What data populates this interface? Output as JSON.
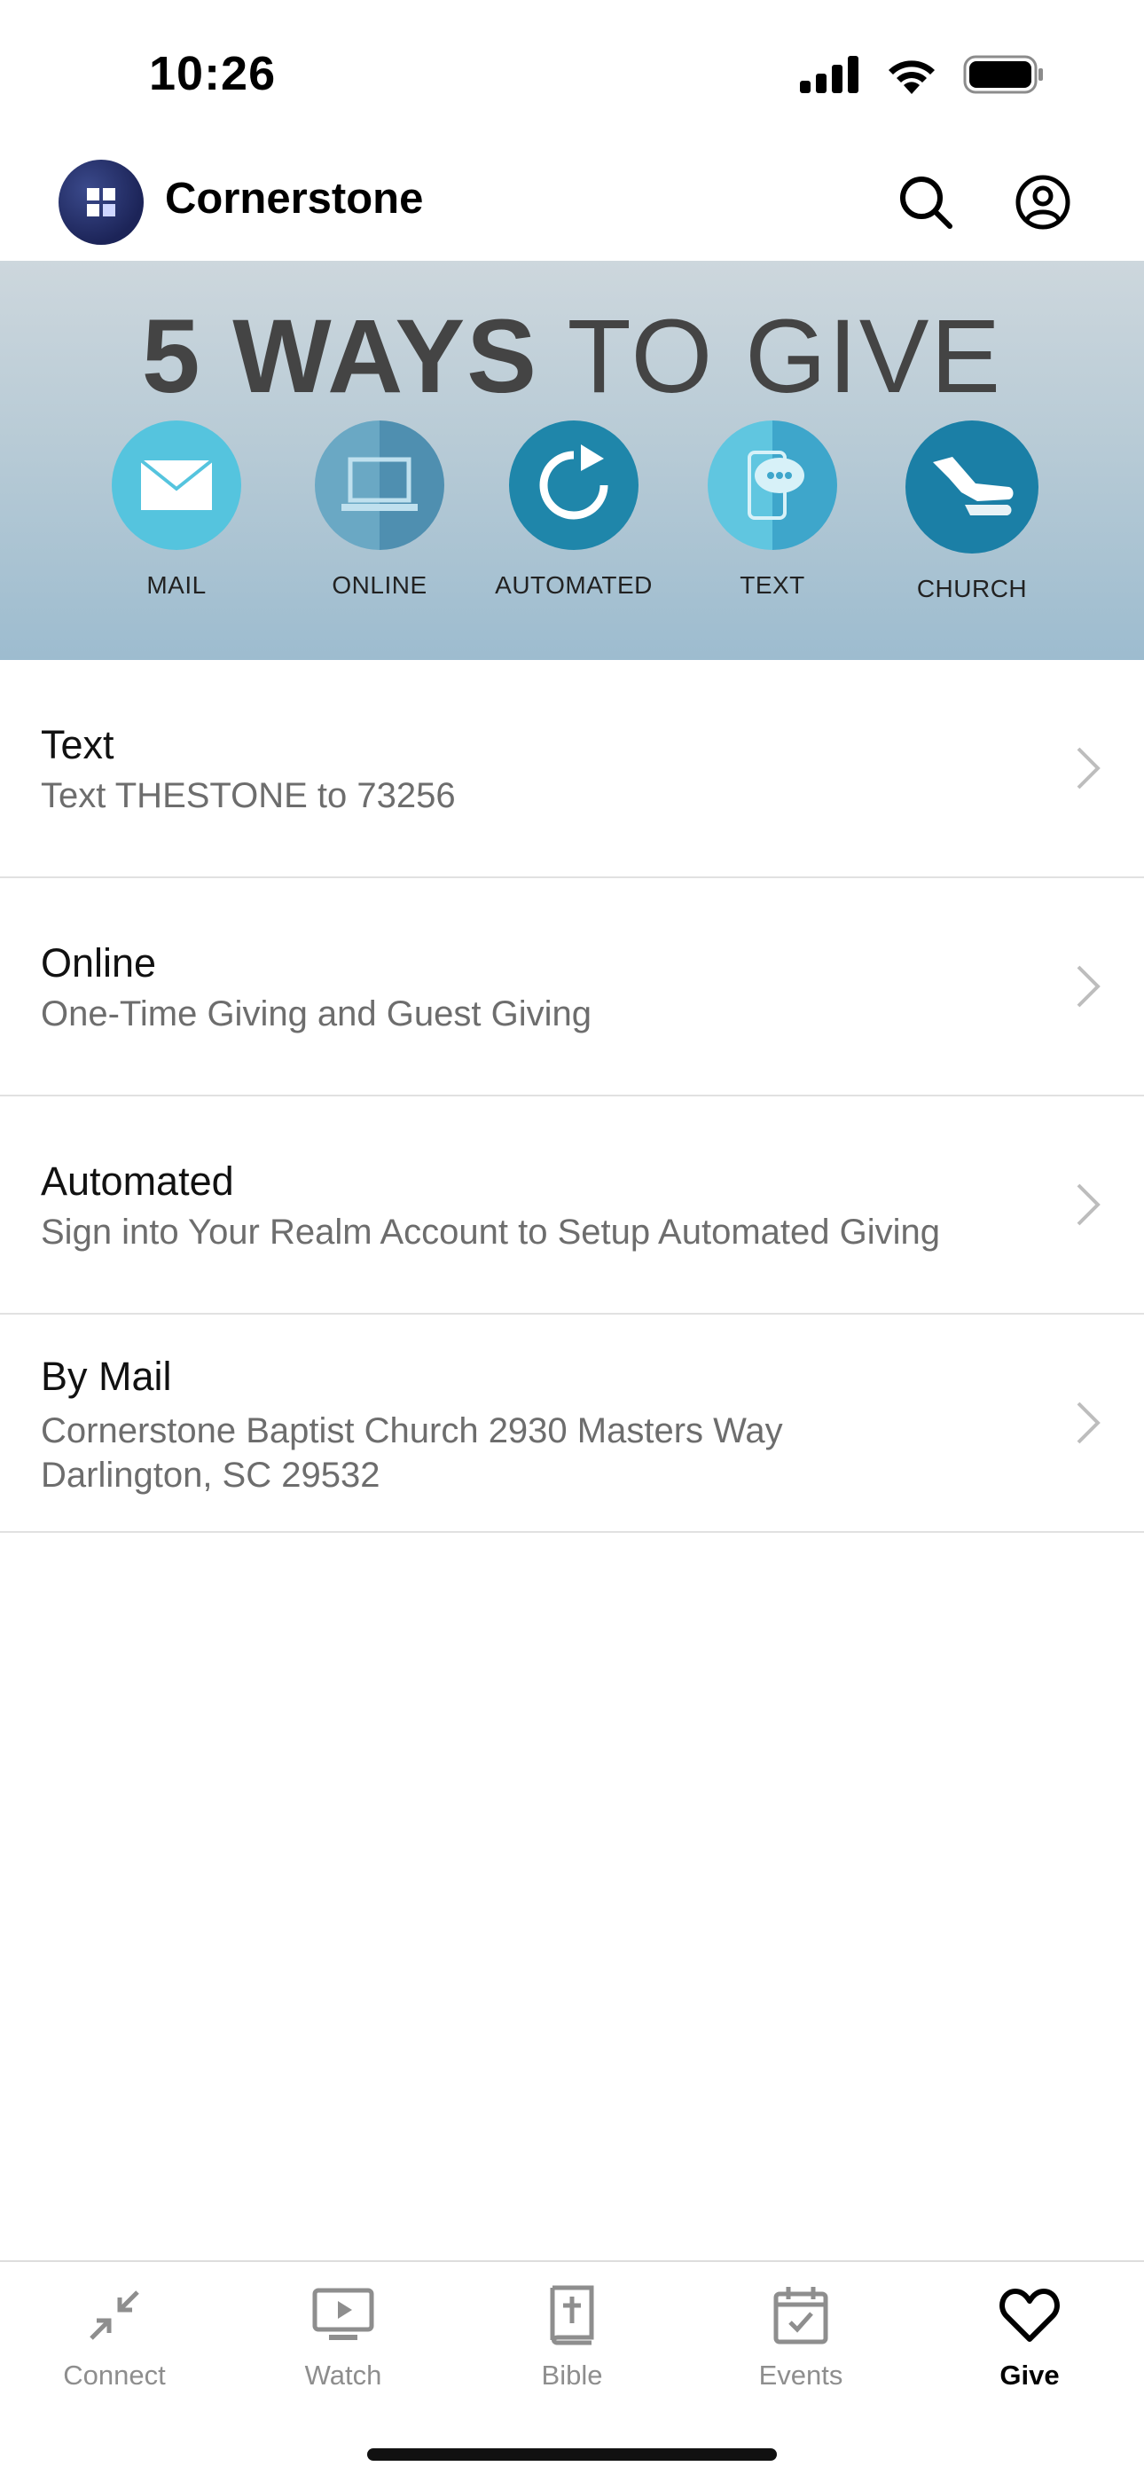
{
  "status_bar": {
    "time": "10:26"
  },
  "header": {
    "title": "Cornerstone",
    "icons": [
      "search-icon",
      "profile-icon"
    ]
  },
  "banner": {
    "title_bold": "5 WAYS",
    "title_rest": "TO GIVE",
    "ways": [
      {
        "label": "MAIL",
        "icon": "envelope-icon"
      },
      {
        "label": "ONLINE",
        "icon": "laptop-icon"
      },
      {
        "label": "AUTOMATED",
        "icon": "refresh-icon"
      },
      {
        "label": "TEXT",
        "icon": "chat-phone-icon"
      },
      {
        "label": "CHURCH",
        "icon": "giving-hands-icon"
      }
    ]
  },
  "give_options": [
    {
      "title": "Text",
      "subtitle": "Text THESTONE to 73256"
    },
    {
      "title": "Online",
      "subtitle": "One-Time Giving and Guest Giving"
    },
    {
      "title": "Automated",
      "subtitle": "Sign into Your Realm Account to Setup Automated Giving"
    },
    {
      "title": "By Mail",
      "subtitle": "Cornerstone Baptist Church 2930 Masters Way Darlington, SC 29532"
    }
  ],
  "tabs": [
    {
      "label": "Connect",
      "icon": "connect-arrows-icon",
      "active": false
    },
    {
      "label": "Watch",
      "icon": "play-screen-icon",
      "active": false
    },
    {
      "label": "Bible",
      "icon": "bible-icon",
      "active": false
    },
    {
      "label": "Events",
      "icon": "calendar-check-icon",
      "active": false
    },
    {
      "label": "Give",
      "icon": "heart-icon",
      "active": true
    }
  ],
  "colors": {
    "accent": "#000000",
    "inactive_tab": "#8e8e8e",
    "subtitle": "#6d6d6d",
    "banner_teal": "#2a8db0"
  }
}
